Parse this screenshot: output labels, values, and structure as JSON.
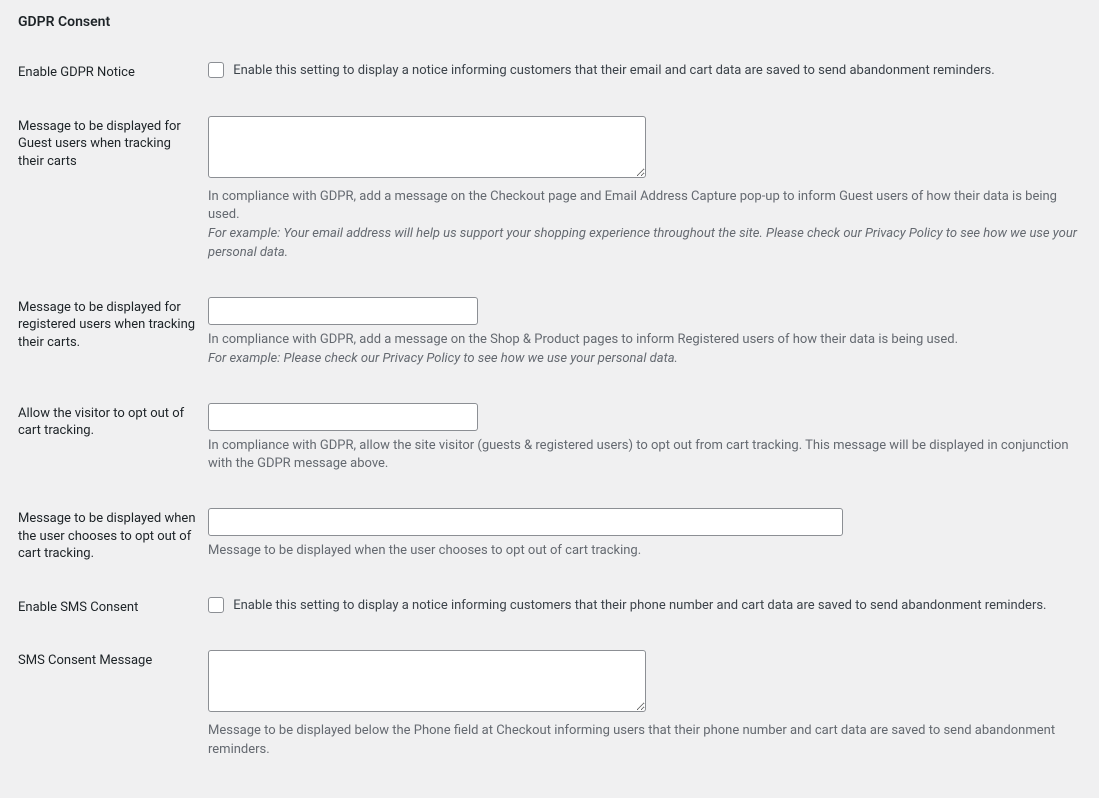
{
  "heading": "GDPR Consent",
  "rows": {
    "enable_gdpr": {
      "label": "Enable GDPR Notice",
      "cb_text": "Enable this setting to display a notice informing customers that their email and cart data are saved to send abandonment reminders."
    },
    "guest_msg": {
      "label": "Message to be displayed for Guest users when tracking their carts",
      "desc_line1": "In compliance with GDPR, add a message on the Checkout page and Email Address Capture pop-up to inform Guest users of how their data is being used.",
      "desc_example": "For example: Your email address will help us support your shopping experience throughout the site. Please check our Privacy Policy to see how we use your personal data.",
      "value": ""
    },
    "reg_msg": {
      "label": "Message to be displayed for registered users when tracking their carts.",
      "desc_line1": "In compliance with GDPR, add a message on the Shop & Product pages to inform Registered users of how their data is being used.",
      "desc_example": "For example: Please check our Privacy Policy to see how we use your personal data.",
      "value": ""
    },
    "opt_out": {
      "label": "Allow the visitor to opt out of cart tracking.",
      "desc": "In compliance with GDPR, allow the site visitor (guests & registered users) to opt out from cart tracking. This message will be displayed in conjunction with the GDPR message above.",
      "value": ""
    },
    "opt_out_msg": {
      "label": "Message to be displayed when the user chooses to opt out of cart tracking.",
      "desc": "Message to be displayed when the user chooses to opt out of cart tracking.",
      "value": ""
    },
    "enable_sms": {
      "label": "Enable SMS Consent",
      "cb_text": "Enable this setting to display a notice informing customers that their phone number and cart data are saved to send abandonment reminders."
    },
    "sms_msg": {
      "label": "SMS Consent Message",
      "desc": "Message to be displayed below the Phone field at Checkout informing users that their phone number and cart data are saved to send abandonment reminders.",
      "value": ""
    }
  }
}
